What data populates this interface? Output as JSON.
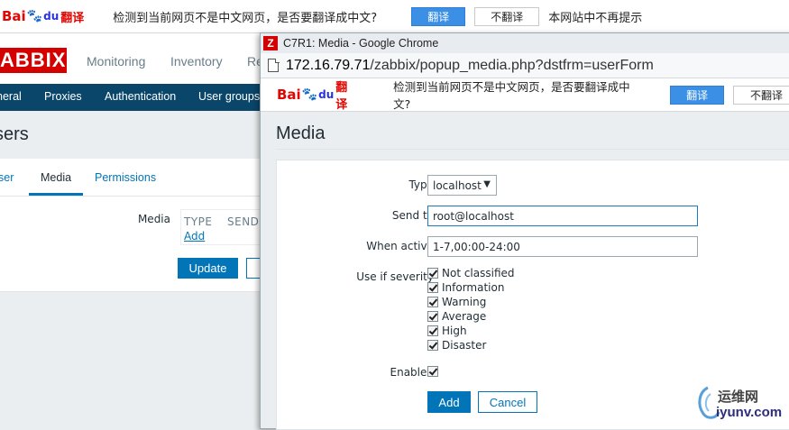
{
  "browser_translate_bar": {
    "logo_text": "Bai",
    "logo_du": "du",
    "logo_fy": "翻译",
    "message": "检测到当前网页不是中文网页，是否要翻译成中文?",
    "translate_button": "翻译",
    "dont_translate_button": "不翻译",
    "never_link": "本网站中不再提示"
  },
  "zabbix": {
    "logo": "ABBIX",
    "top_menu": [
      "Monitoring",
      "Inventory",
      "Re"
    ],
    "sub_menu": [
      "neral",
      "Proxies",
      "Authentication",
      "User groups"
    ],
    "page_title": "sers",
    "tabs": [
      "ser",
      "Media",
      "Permissions"
    ],
    "media_label": "Media",
    "media_table_headers": [
      "TYPE",
      "SEND"
    ],
    "media_add": "Add",
    "update_button": "Update"
  },
  "popup": {
    "window_title": "C7R1: Media - Google Chrome",
    "url_host": "172.16.79.71",
    "url_path": "/zabbix/popup_media.php?dstfrm=userForm",
    "translate_bar": {
      "message": "检测到当前网页不是中文网页，是否要翻译成中文?",
      "translate_button": "翻译",
      "dont_translate_button": "不翻译"
    },
    "heading": "Media",
    "form": {
      "type_label": "Type",
      "type_value": "localhost",
      "send_to_label": "Send to",
      "send_to_value": "root@localhost",
      "when_active_label": "When active",
      "when_active_value": "1-7,00:00-24:00",
      "severity_label": "Use if severity",
      "severities": [
        "Not classified",
        "Information",
        "Warning",
        "Average",
        "High",
        "Disaster"
      ],
      "enabled_label": "Enabled",
      "add_button": "Add",
      "cancel_button": "Cancel"
    }
  },
  "watermark": {
    "line1": "运维网",
    "line2": "iyunv.com"
  }
}
